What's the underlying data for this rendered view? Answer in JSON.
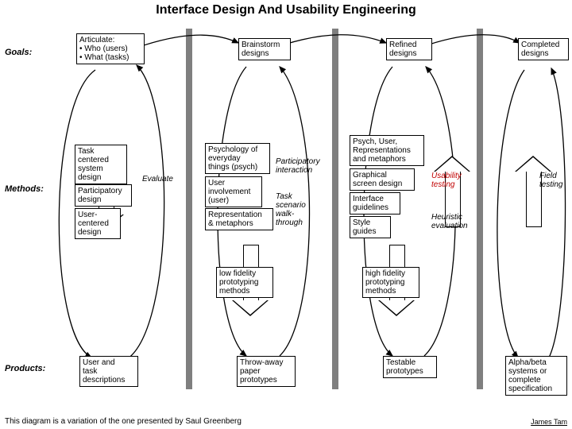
{
  "title": "Interface Design And Usability Engineering",
  "rows": {
    "goals": "Goals:",
    "methods": "Methods:",
    "products": "Products:"
  },
  "goals": {
    "articulate": "Articulate:\n• Who (users)\n• What (tasks)",
    "brainstorm": "Brainstorm\ndesigns",
    "refined": "Refined\ndesigns",
    "completed": "Completed\ndesigns"
  },
  "methods": {
    "task_centered": "Task\ncentered\nsystem\ndesign",
    "participatory_design": "Participatory\ndesign",
    "user_centered": "User-\ncentered\ndesign",
    "evaluate": "Evaluate",
    "psych_everyday": "Psychology of\neveryday\nthings (psych)",
    "user_involvement": "User\ninvolvement\n(user)",
    "representation": "Representation\n& metaphors",
    "participatory_interaction": "Participatory\ninteraction",
    "task_scenario": "Task\nscenario\nwalk-\nthrough",
    "psych_user_rep": "Psych, User,\nRepresentations\nand metaphors",
    "graphical": "Graphical\nscreen design",
    "interface_guidelines": "Interface\nguidelines",
    "style_guides": "Style\nguides",
    "usability_testing": "Usability\ntesting",
    "heuristic": "Heuristic\nevaluation",
    "field_testing": "Field\ntesting",
    "low_fi": "low fidelity\nprototyping\nmethods",
    "high_fi": "high fidelity\nprototyping\nmethods"
  },
  "products": {
    "user_task": "User and\ntask\ndescriptions",
    "throwaway": "Throw-away\npaper\nprototypes",
    "testable": "Testable\nprototypes",
    "alpha_beta": "Alpha/beta\nsystems or\ncomplete\nspecification"
  },
  "footnote": "This diagram is a variation of the one presented by Saul Greenberg",
  "credit": "James Tam"
}
